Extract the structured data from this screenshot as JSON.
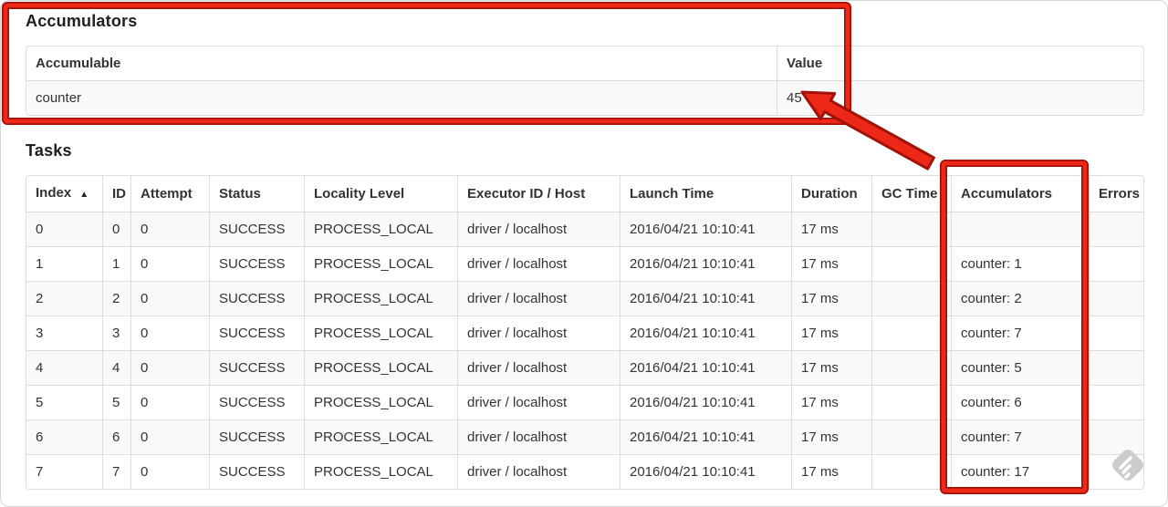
{
  "colors": {
    "annotation_red": "#ee2817",
    "annotation_red_dark": "#a01208",
    "table_border": "#dddddd",
    "row_stripe": "#f9f9f9",
    "text": "#333333",
    "watermark_gray": "#cccccc"
  },
  "accumulators_section": {
    "title": "Accumulators",
    "table": {
      "headers": [
        {
          "label": "Accumulable"
        },
        {
          "label": "Value"
        }
      ],
      "rows": [
        [
          "counter",
          "45"
        ]
      ]
    }
  },
  "tasks_section": {
    "title": "Tasks",
    "table": {
      "headers": [
        {
          "label": "Index",
          "sort_arrow": "▲"
        },
        {
          "label": "ID"
        },
        {
          "label": "Attempt"
        },
        {
          "label": "Status"
        },
        {
          "label": "Locality Level"
        },
        {
          "label": "Executor ID / Host"
        },
        {
          "label": "Launch Time"
        },
        {
          "label": "Duration"
        },
        {
          "label": "GC Time"
        },
        {
          "label": "Accumulators"
        },
        {
          "label": "Errors"
        }
      ],
      "rows": [
        [
          "0",
          "0",
          "0",
          "SUCCESS",
          "PROCESS_LOCAL",
          "driver / localhost",
          "2016/04/21 10:10:41",
          "17 ms",
          "",
          "",
          ""
        ],
        [
          "1",
          "1",
          "0",
          "SUCCESS",
          "PROCESS_LOCAL",
          "driver / localhost",
          "2016/04/21 10:10:41",
          "17 ms",
          "",
          "counter: 1",
          ""
        ],
        [
          "2",
          "2",
          "0",
          "SUCCESS",
          "PROCESS_LOCAL",
          "driver / localhost",
          "2016/04/21 10:10:41",
          "17 ms",
          "",
          "counter: 2",
          ""
        ],
        [
          "3",
          "3",
          "0",
          "SUCCESS",
          "PROCESS_LOCAL",
          "driver / localhost",
          "2016/04/21 10:10:41",
          "17 ms",
          "",
          "counter: 7",
          ""
        ],
        [
          "4",
          "4",
          "0",
          "SUCCESS",
          "PROCESS_LOCAL",
          "driver / localhost",
          "2016/04/21 10:10:41",
          "17 ms",
          "",
          "counter: 5",
          ""
        ],
        [
          "5",
          "5",
          "0",
          "SUCCESS",
          "PROCESS_LOCAL",
          "driver / localhost",
          "2016/04/21 10:10:41",
          "17 ms",
          "",
          "counter: 6",
          ""
        ],
        [
          "6",
          "6",
          "0",
          "SUCCESS",
          "PROCESS_LOCAL",
          "driver / localhost",
          "2016/04/21 10:10:41",
          "17 ms",
          "",
          "counter: 7",
          ""
        ],
        [
          "7",
          "7",
          "0",
          "SUCCESS",
          "PROCESS_LOCAL",
          "driver / localhost",
          "2016/04/21 10:10:41",
          "17 ms",
          "",
          "counter: 17",
          ""
        ]
      ]
    }
  }
}
